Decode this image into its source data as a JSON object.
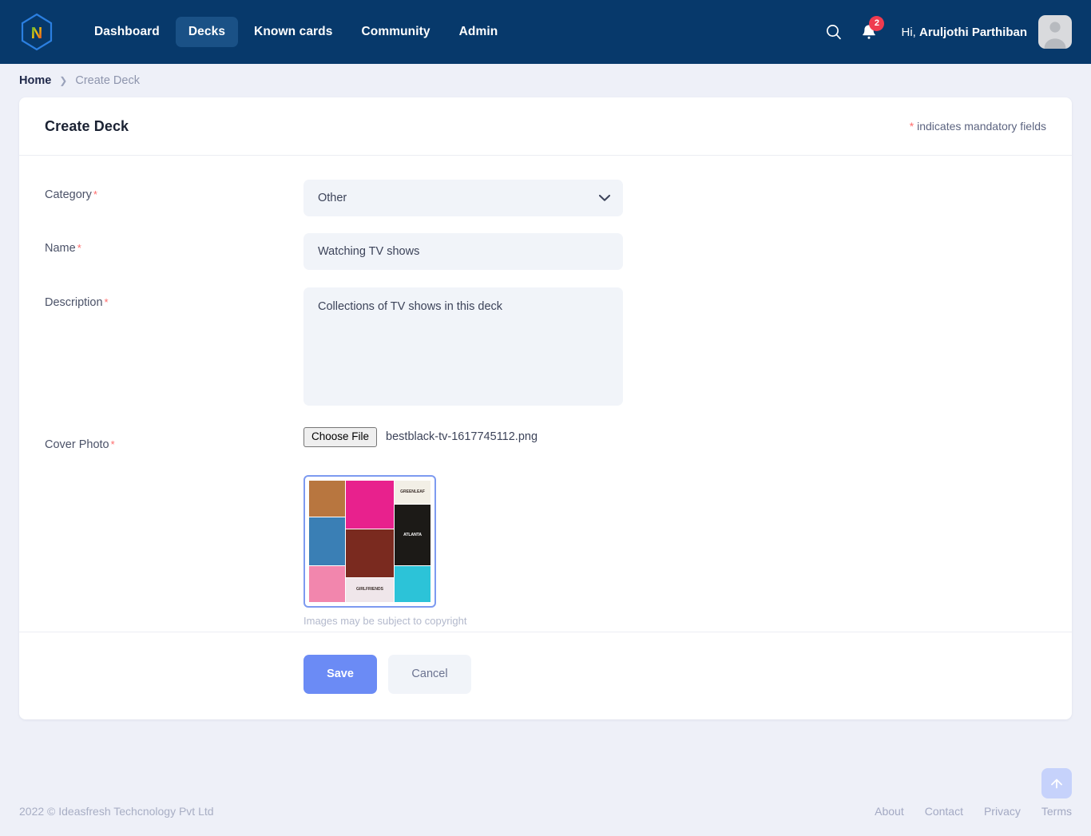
{
  "header": {
    "logo_icon": "hexagon-n-logo",
    "nav": [
      {
        "label": "Dashboard",
        "active": false
      },
      {
        "label": "Decks",
        "active": true
      },
      {
        "label": "Known cards",
        "active": false
      },
      {
        "label": "Community",
        "active": false
      },
      {
        "label": "Admin",
        "active": false
      }
    ],
    "search_icon": "search-icon",
    "notification_icon": "bell-icon",
    "notification_count": "2",
    "greeting_prefix": "Hi,",
    "user_name": "Aruljothi Parthiban",
    "avatar_icon": "user-avatar-icon",
    "background_color": "#07396b",
    "active_tab_color": "#1a5186"
  },
  "breadcrumb": {
    "home": "Home",
    "separator": "›",
    "current": "Create Deck"
  },
  "card": {
    "title": "Create Deck",
    "mandatory_note": "indicates mandatory fields",
    "mandatory_marker": "*"
  },
  "form": {
    "category": {
      "label": "Category",
      "required_marker": "*",
      "value": "Other",
      "options": [
        "Other"
      ],
      "chevron_icon": "chevron-down-icon"
    },
    "name": {
      "label": "Name",
      "required_marker": "*",
      "value": "Watching TV shows",
      "placeholder": ""
    },
    "description": {
      "label": "Description",
      "required_marker": "*",
      "value": "Collections of TV shows in this deck",
      "placeholder": ""
    },
    "cover_photo": {
      "label": "Cover Photo",
      "required_marker": "*",
      "choose_file_label": "Choose File",
      "file_name": "bestblack-tv-1617745112.png",
      "preview_alt": "tv-show-poster-collage",
      "copyright_note": "Images may be subject to copyright",
      "preview_border_color": "#7d9af0"
    }
  },
  "actions": {
    "save_label": "Save",
    "cancel_label": "Cancel",
    "save_color": "#6b8bf5"
  },
  "footer": {
    "copyright": "2022 © Ideasfresh Techcnology Pvt Ltd",
    "links": [
      "About",
      "Contact",
      "Privacy",
      "Terms"
    ],
    "scroll_top_icon": "arrow-up-icon"
  },
  "collage_tiles": [
    {
      "label": "",
      "bg": "#b8763f",
      "col": "1 / span 3",
      "row": "1 / span 3"
    },
    {
      "label": "",
      "bg": "#e8218d",
      "col": "4 / span 4",
      "row": "1 / span 4"
    },
    {
      "label": "GREENLEAF",
      "bg": "#f2efe6",
      "col": "8 / span 3",
      "row": "1 / span 2"
    },
    {
      "label": "",
      "bg": "#3a7fb5",
      "col": "1 / span 3",
      "row": "4 / span 4"
    },
    {
      "label": "",
      "bg": "#7a2a1f",
      "col": "4 / span 4",
      "row": "5 / span 4"
    },
    {
      "label": "ATLANTA",
      "bg": "#1c1a17",
      "col": "8 / span 3",
      "row": "3 / span 5"
    },
    {
      "label": "",
      "bg": "#f286ad",
      "col": "1 / span 3",
      "row": "8 / span 3"
    },
    {
      "label": "GIRLFRIENDS",
      "bg": "#efe6ea",
      "col": "4 / span 4",
      "row": "9 / span 2"
    },
    {
      "label": "",
      "bg": "#2cc3d8",
      "col": "8 / span 3",
      "row": "8 / span 3"
    }
  ]
}
